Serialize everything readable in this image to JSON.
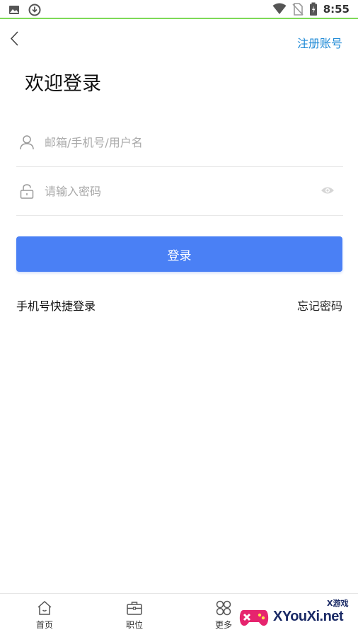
{
  "status_bar": {
    "time": "8:55",
    "left_icons": [
      "image-icon",
      "download-icon"
    ],
    "right_icons": [
      "wifi-icon",
      "no-sim-icon",
      "battery-icon"
    ]
  },
  "header": {
    "register_label": "注册账号",
    "title": "欢迎登录"
  },
  "form": {
    "account_placeholder": "邮箱/手机号/用户名",
    "account_value": "",
    "password_placeholder": "请输入密码",
    "password_value": "",
    "login_label": "登录",
    "quick_login_label": "手机号快捷登录",
    "forgot_label": "忘记密码"
  },
  "bottom_nav": {
    "items": [
      {
        "label": "首页",
        "icon": "home-icon"
      },
      {
        "label": "职位",
        "icon": "briefcase-icon"
      },
      {
        "label": "更多",
        "icon": "grid-icon"
      }
    ]
  },
  "watermark": {
    "brand": "XYouXi.net",
    "sub": "X游戏"
  },
  "colors": {
    "accent": "#4a80f5",
    "link": "#1f8ad6",
    "status_line": "#7ed957"
  }
}
